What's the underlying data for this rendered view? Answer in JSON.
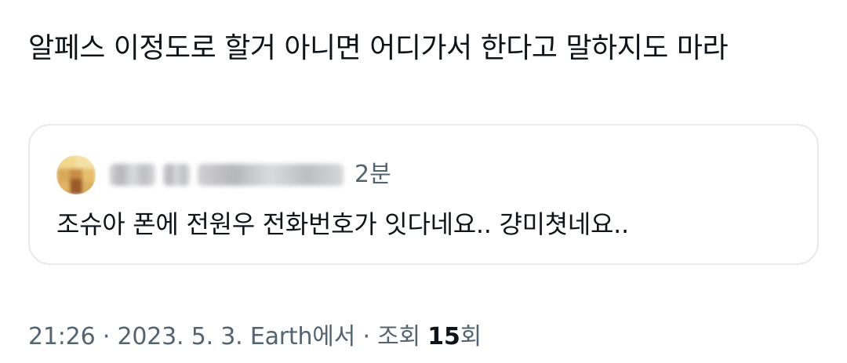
{
  "post": {
    "text": "알페스 이정도로 할거 아니면 어디가서 한다고 말하지도 마라"
  },
  "quoted_post": {
    "author_name_redacted": "",
    "time_ago": "2분",
    "text": "조슈아 폰에 전원우 전화번호가 잇다네요.. 걍미쳣네요.."
  },
  "meta": {
    "time": "21:26",
    "separator1": "·",
    "date": "2023. 5. 3.",
    "source": "Earth에서",
    "separator2": "·",
    "views_label": "조회",
    "views_count": "15",
    "views_suffix": "회"
  },
  "colors": {
    "text_primary": "#0f1419",
    "text_secondary": "#536471",
    "card_border": "#e7e9ea"
  }
}
